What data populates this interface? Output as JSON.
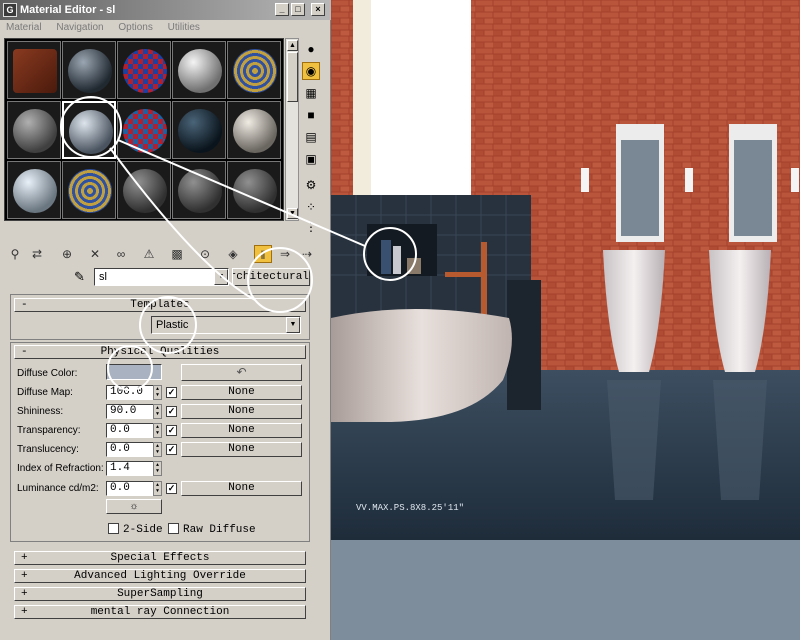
{
  "window": {
    "title": "Material Editor - sl",
    "app_icon": "max-logo-icon"
  },
  "menu": [
    "Material",
    "Navigation",
    "Options",
    "Utilities"
  ],
  "material": {
    "name": "sl",
    "type_button": "Architectural"
  },
  "templates_rollout": {
    "title": "Templates",
    "template_value": "Plastic"
  },
  "physical_qualities": {
    "title": "Physical Qualities",
    "diffuse_color_label": "Diffuse Color:",
    "diffuse_color_hex": "#a8b2c0",
    "rows": [
      {
        "label": "Diffuse Map:",
        "value": "100.0",
        "checked": true,
        "map": "None"
      },
      {
        "label": "Shininess:",
        "value": "90.0",
        "checked": true,
        "map": "None"
      },
      {
        "label": "Transparency:",
        "value": "0.0",
        "checked": true,
        "map": "None"
      },
      {
        "label": "Translucency:",
        "value": "0.0",
        "checked": true,
        "map": "None"
      },
      {
        "label": "Index of Refraction:",
        "value": "1.4"
      },
      {
        "label": "Luminance cd/m2:",
        "value": "0.0",
        "checked": true,
        "map": "None"
      }
    ],
    "two_side_label": "2-Side",
    "raw_diffuse_label": "Raw Diffuse"
  },
  "collapsed_rollouts": [
    {
      "sign": "+",
      "title": "Special Effects"
    },
    {
      "sign": "+",
      "title": "Advanced Lighting Override"
    },
    {
      "sign": "+",
      "title": "SuperSampling"
    },
    {
      "sign": "+",
      "title": "mental ray Connection"
    }
  ],
  "render_caption": "VV.MAX.PS.8X8.25'11\"",
  "colors": {
    "panel": "#d4d0c8",
    "selected_tool": "#f0c040",
    "brick": "#b04a32"
  }
}
